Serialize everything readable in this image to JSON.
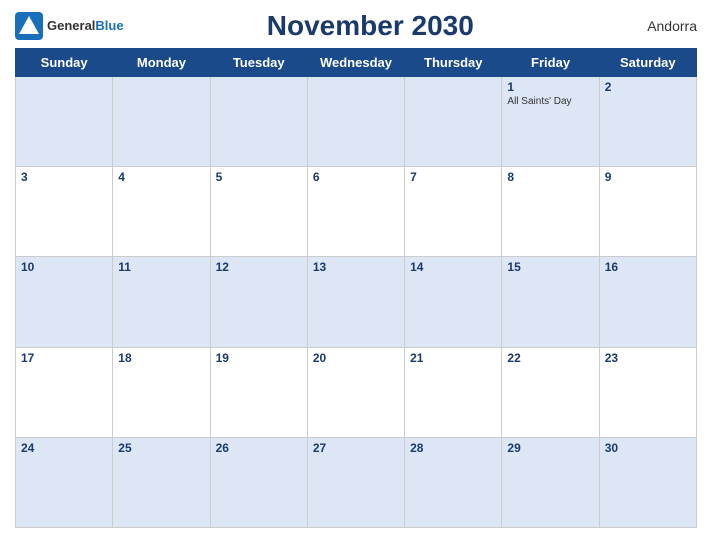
{
  "header": {
    "title": "November 2030",
    "country": "Andorra",
    "logo": {
      "general": "General",
      "blue": "Blue"
    }
  },
  "weekdays": [
    "Sunday",
    "Monday",
    "Tuesday",
    "Wednesday",
    "Thursday",
    "Friday",
    "Saturday"
  ],
  "weeks": [
    [
      {
        "day": "",
        "holiday": ""
      },
      {
        "day": "",
        "holiday": ""
      },
      {
        "day": "",
        "holiday": ""
      },
      {
        "day": "",
        "holiday": ""
      },
      {
        "day": "",
        "holiday": ""
      },
      {
        "day": "1",
        "holiday": "All Saints' Day"
      },
      {
        "day": "2",
        "holiday": ""
      }
    ],
    [
      {
        "day": "3",
        "holiday": ""
      },
      {
        "day": "4",
        "holiday": ""
      },
      {
        "day": "5",
        "holiday": ""
      },
      {
        "day": "6",
        "holiday": ""
      },
      {
        "day": "7",
        "holiday": ""
      },
      {
        "day": "8",
        "holiday": ""
      },
      {
        "day": "9",
        "holiday": ""
      }
    ],
    [
      {
        "day": "10",
        "holiday": ""
      },
      {
        "day": "11",
        "holiday": ""
      },
      {
        "day": "12",
        "holiday": ""
      },
      {
        "day": "13",
        "holiday": ""
      },
      {
        "day": "14",
        "holiday": ""
      },
      {
        "day": "15",
        "holiday": ""
      },
      {
        "day": "16",
        "holiday": ""
      }
    ],
    [
      {
        "day": "17",
        "holiday": ""
      },
      {
        "day": "18",
        "holiday": ""
      },
      {
        "day": "19",
        "holiday": ""
      },
      {
        "day": "20",
        "holiday": ""
      },
      {
        "day": "21",
        "holiday": ""
      },
      {
        "day": "22",
        "holiday": ""
      },
      {
        "day": "23",
        "holiday": ""
      }
    ],
    [
      {
        "day": "24",
        "holiday": ""
      },
      {
        "day": "25",
        "holiday": ""
      },
      {
        "day": "26",
        "holiday": ""
      },
      {
        "day": "27",
        "holiday": ""
      },
      {
        "day": "28",
        "holiday": ""
      },
      {
        "day": "29",
        "holiday": ""
      },
      {
        "day": "30",
        "holiday": ""
      }
    ]
  ]
}
